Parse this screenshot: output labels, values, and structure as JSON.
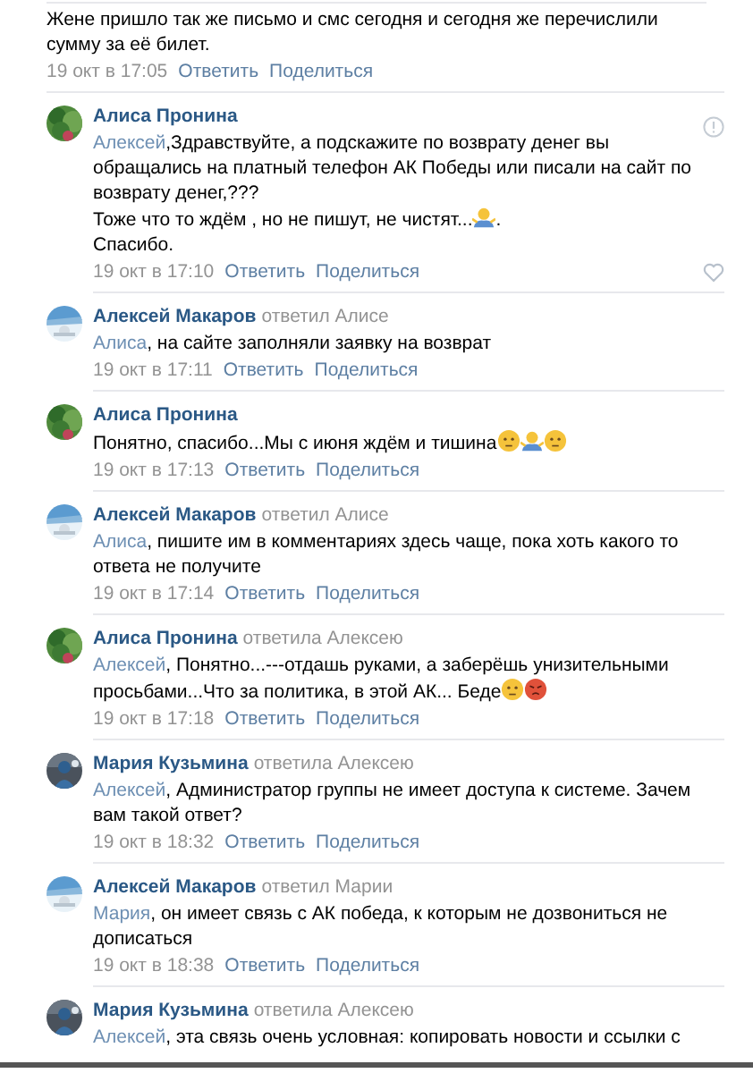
{
  "comments": [
    {
      "hovered": false,
      "parts": [
        {
          "kind": "text",
          "value": "Жене пришло так же письмо и смс сегодня и сегодня же перечислили сумму за её билет."
        }
      ],
      "time": "19 окт в 17:05",
      "actions": [
        "Ответить",
        "Поделиться"
      ]
    },
    {
      "author": "Алиса Пронина",
      "hovered": true,
      "parts": [
        {
          "kind": "mention",
          "value": "Алексей"
        },
        {
          "kind": "text",
          "value": ",Здравствуйте, а подскажите по возврату денег вы обращались на платный телефон АК Победы или писали на сайт по возврату денег,???"
        },
        {
          "kind": "break"
        },
        {
          "kind": "text",
          "value": "Тоже что то ждём , но не пишут, не чистят..."
        },
        {
          "kind": "shrug"
        },
        {
          "kind": "text",
          "value": "."
        },
        {
          "kind": "break"
        },
        {
          "kind": "text",
          "value": "Спасибо."
        }
      ],
      "time": "19 окт в 17:10",
      "actions": [
        "Ответить",
        "Поделиться"
      ]
    },
    {
      "author": "Алексей Макаров",
      "reply_to": "ответил Алисе",
      "hovered": false,
      "parts": [
        {
          "kind": "mention",
          "value": "Алиса"
        },
        {
          "kind": "text",
          "value": ", на сайте заполняли заявку на возврат"
        }
      ],
      "time": "19 окт в 17:11",
      "actions": [
        "Ответить",
        "Поделиться"
      ]
    },
    {
      "author": "Алиса Пронина",
      "hovered": false,
      "parts": [
        {
          "kind": "text",
          "value": "Понятно, спасибо...Мы с июня ждём и тишина"
        },
        {
          "kind": "face"
        },
        {
          "kind": "shrug"
        },
        {
          "kind": "face"
        }
      ],
      "time": "19 окт в 17:13",
      "actions": [
        "Ответить",
        "Поделиться"
      ]
    },
    {
      "author": "Алексей Макаров",
      "reply_to": "ответил Алисе",
      "hovered": false,
      "parts": [
        {
          "kind": "mention",
          "value": "Алиса"
        },
        {
          "kind": "text",
          "value": ", пишите им в комментариях здесь чаще, пока хоть какого то ответа не получите"
        }
      ],
      "time": "19 окт в 17:14",
      "actions": [
        "Ответить",
        "Поделиться"
      ]
    },
    {
      "author": "Алиса Пронина",
      "reply_to": "ответила Алексею",
      "hovered": false,
      "parts": [
        {
          "kind": "mention",
          "value": "Алексей"
        },
        {
          "kind": "text",
          "value": ", Понятно...---отдашь руками, а заберёшь унизительными просьбами...Что за политика, в этой АК... Беде"
        },
        {
          "kind": "face"
        },
        {
          "kind": "angry"
        }
      ],
      "time": "19 окт в 17:18",
      "actions": [
        "Ответить",
        "Поделиться"
      ]
    },
    {
      "author": "Мария Кузьмина",
      "reply_to": "ответила Алексею",
      "hovered": false,
      "parts": [
        {
          "kind": "mention",
          "value": "Алексей"
        },
        {
          "kind": "text",
          "value": ", Администратор группы не имеет доступа к системе. Зачем вам такой ответ?"
        }
      ],
      "time": "19 окт в 18:32",
      "actions": [
        "Ответить",
        "Поделиться"
      ]
    },
    {
      "author": "Алексей Макаров",
      "reply_to": "ответил Марии",
      "hovered": false,
      "parts": [
        {
          "kind": "mention",
          "value": "Мария"
        },
        {
          "kind": "text",
          "value": ", он имеет связь с АК победа, к которым не дозвониться не дописаться"
        }
      ],
      "time": "19 окт в 18:38",
      "actions": [
        "Ответить",
        "Поделиться"
      ]
    },
    {
      "author": "Мария Кузьмина",
      "reply_to": "ответила Алексею",
      "hovered": false,
      "parts": [
        {
          "kind": "mention",
          "value": "Алексей"
        },
        {
          "kind": "text",
          "value": ", эта связь очень условная: копировать новости и ссылки с"
        }
      ]
    }
  ]
}
